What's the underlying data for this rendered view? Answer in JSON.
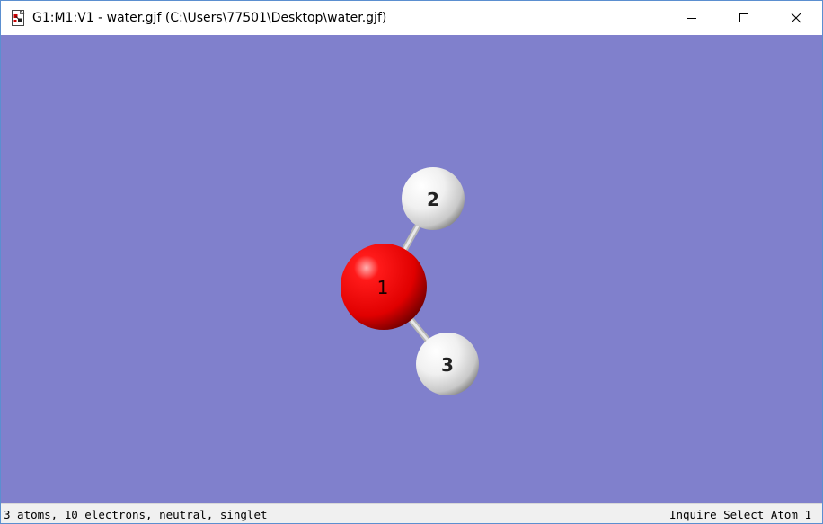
{
  "window": {
    "title": "G1:M1:V1 - water.gjf (C:\\Users\\77501\\Desktop\\water.gjf)",
    "controls": {
      "minimize_icon": "minimize-icon",
      "maximize_icon": "maximize-icon",
      "close_icon": "close-icon"
    }
  },
  "viewer": {
    "background_color": "#8080cc",
    "atoms": [
      {
        "number": "1",
        "element": "O",
        "color": "#ff0000"
      },
      {
        "number": "2",
        "element": "H",
        "color": "#f2f2f2"
      },
      {
        "number": "3",
        "element": "H",
        "color": "#f2f2f2"
      }
    ],
    "bonds": [
      {
        "from": "1",
        "to": "2"
      },
      {
        "from": "1",
        "to": "3"
      }
    ]
  },
  "statusbar": {
    "molecule_info": "3 atoms, 10 electrons, neutral, singlet",
    "mode": "Inquire Select Atom 1"
  }
}
